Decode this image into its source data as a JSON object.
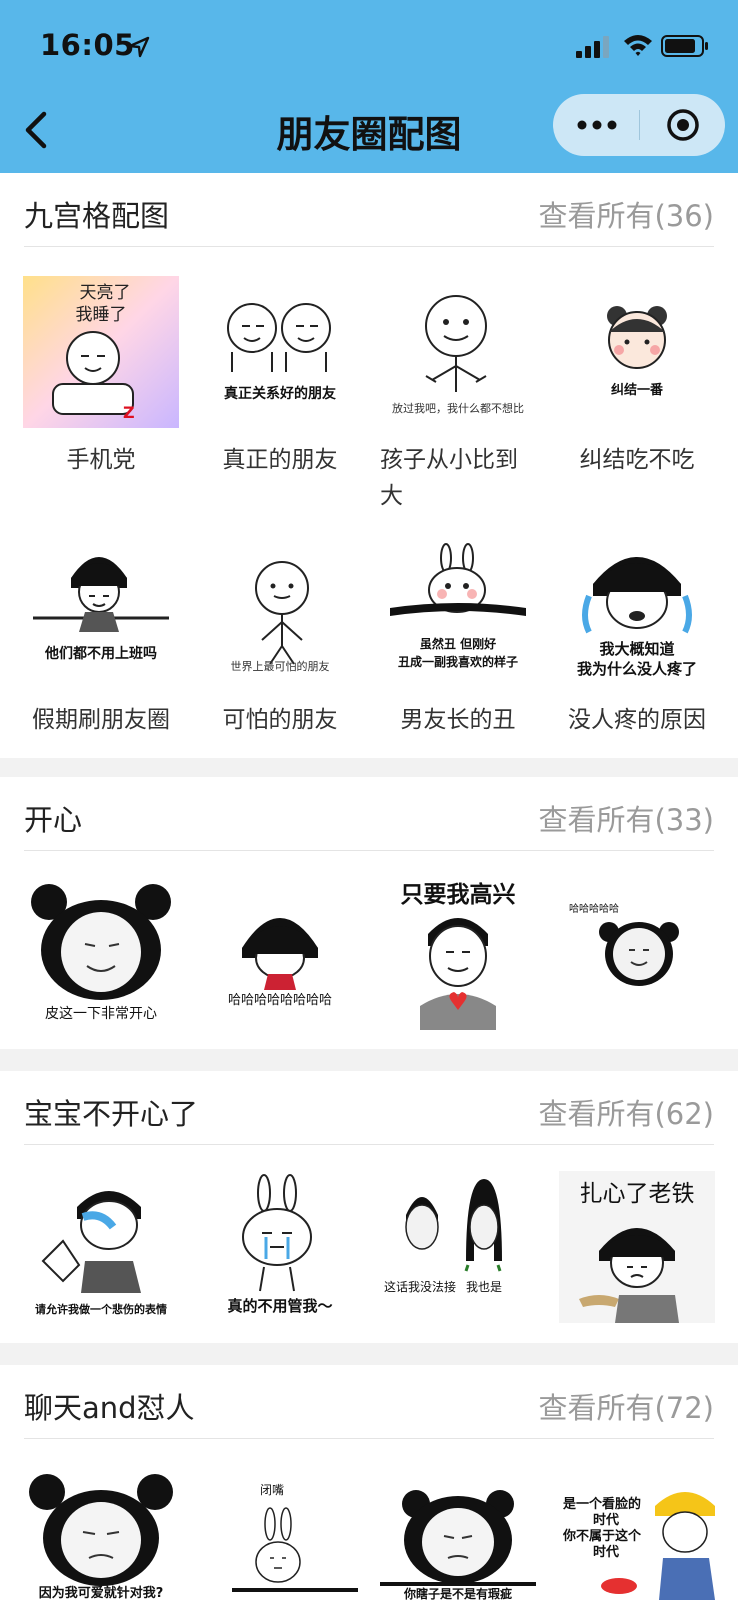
{
  "status_bar": {
    "time": "16:05"
  },
  "nav": {
    "title": "朋友圈配图"
  },
  "sections": [
    {
      "title": "九宫格配图",
      "more": "查看所有(36)",
      "items": [
        {
          "caption": "手机党",
          "image_text": [
            "天亮了",
            "我睡了"
          ]
        },
        {
          "caption": "真正的朋友",
          "image_text": [
            "真正关系好的朋友"
          ]
        },
        {
          "caption": "孩子从小比到大",
          "image_text": [
            "放过我吧，我什么都不想比"
          ]
        },
        {
          "caption": "纠结吃不吃",
          "image_text": [
            "纠结一番"
          ]
        },
        {
          "caption": "假期刷朋友圈",
          "image_text": [
            "他们都不用上班吗"
          ]
        },
        {
          "caption": "可怕的朋友",
          "image_text": [
            "世界上最可怕的朋友"
          ]
        },
        {
          "caption": "男友长的丑",
          "image_text": [
            "虽然丑 但刚好",
            "丑成一副我喜欢的样子"
          ]
        },
        {
          "caption": "没人疼的原因",
          "image_text": [
            "我大概知道",
            "我为什么没人疼了"
          ]
        }
      ]
    },
    {
      "title": "开心",
      "more": "查看所有(33)",
      "items": [
        {
          "image_text": [
            "皮这一下非常开心"
          ]
        },
        {
          "image_text": [
            "哈哈哈哈哈哈哈哈"
          ]
        },
        {
          "image_text": [
            "只要我高兴"
          ]
        },
        {
          "image_text": [
            "哈哈哈哈哈"
          ]
        }
      ]
    },
    {
      "title": "宝宝不开心了",
      "more": "查看所有(62)",
      "items": [
        {
          "image_text": [
            "请允许我做一个悲伤的表情"
          ]
        },
        {
          "image_text": [
            "真的不用管我～"
          ]
        },
        {
          "image_text": [
            "这话我没法接",
            "我也是"
          ]
        },
        {
          "image_text": [
            "扎心了老铁"
          ]
        }
      ]
    },
    {
      "title": "聊天and怼人",
      "more": "查看所有(72)",
      "items": [
        {
          "image_text": [
            "因为我可爱就针对我?"
          ]
        },
        {
          "image_text": [
            "闭嘴"
          ]
        },
        {
          "image_text": [
            "你瞎子是不是有瑕疵"
          ]
        },
        {
          "image_text": [
            "是一个看脸的",
            "时代",
            "你不属于这个",
            "时代"
          ]
        }
      ]
    }
  ],
  "colors": {
    "header": "#58b7ea",
    "capsule": "#cde7f6",
    "divider": "#e4e4e4",
    "more_text": "#9a9a9a"
  },
  "icons": [
    "location-arrow-icon",
    "signal-icon",
    "wifi-icon",
    "battery-icon",
    "back-chevron-icon",
    "more-dots-icon",
    "target-close-icon"
  ]
}
